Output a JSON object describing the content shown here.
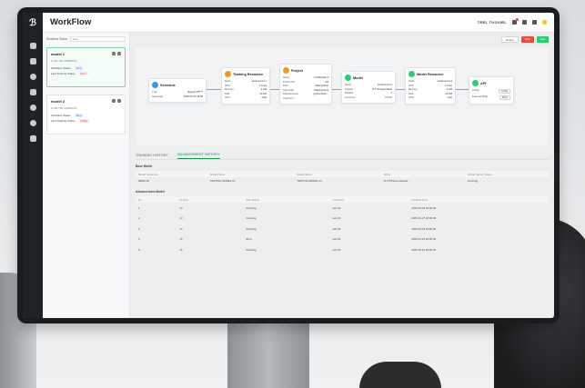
{
  "app": {
    "title": "WorkFlow"
  },
  "topbar": {
    "user_name": "TEEL TUOVIEL"
  },
  "filter": {
    "label": "Workflow Status",
    "value": "Stop"
  },
  "models": [
    {
      "name": "model 1",
      "subtitle": "2 GB / 6E 4 RMEXI%",
      "status_label": "Workflow Status",
      "status_value": "Stop",
      "training_label": "Last Training Status",
      "training_value": "Error"
    },
    {
      "name": "model 2",
      "subtitle": "2 GB / 6E 4 RMEXI%",
      "status_label": "Workflow Status",
      "status_value": "Stop",
      "training_label": "Last Training Status",
      "training_value": "Finish"
    }
  ],
  "actions": {
    "delete": "Delete",
    "stop": "Stop",
    "edit": "Edit"
  },
  "nodes": {
    "schedule": {
      "title": "Schedule",
      "rows": [
        [
          "Type",
          "Repeat 0/5**?"
        ],
        [
          "Start Date",
          "2025-01-03 18:00"
        ]
      ]
    },
    "training": {
      "title": "Training Resource",
      "rows": [
        [
          "Node",
          "workerpoint-1"
        ],
        [
          "GPU",
          "2 Core"
        ],
        [
          "Memory",
          "4 GB"
        ],
        [
          "Disk",
          "20 GB"
        ],
        [
          "GPU",
          "GA0"
        ]
      ]
    },
    "project": {
      "title": "Project",
      "rows": [
        [
          "Name",
          "mnistEcode-3"
        ],
        [
          "Python Ver.",
          "3.8"
        ],
        [
          "Path",
          "/data/python"
        ],
        [
          "Date Path",
          "/data/python3"
        ],
        [
          "Requirements",
          "/python/test/..."
        ],
        [
          "Argument",
          ""
        ]
      ]
    },
    "model": {
      "title": "Model",
      "rows": [
        [
          "Name",
          "workerpoint-3"
        ],
        [
          "Creator",
          "R.1797/secondant"
        ],
        [
          "Replica",
          "1"
        ],
        [
          "Comment",
          "CCCC"
        ]
      ]
    },
    "model_resource": {
      "title": "Model Resource",
      "rows": [
        [
          "Node",
          "workerpoint-4"
        ],
        [
          "GPU",
          "2 Core"
        ],
        [
          "Memory",
          "4 GB"
        ],
        [
          "Disk",
          "20 GB"
        ],
        [
          "GPU",
          "GA0"
        ]
      ]
    },
    "api": {
      "title": "API",
      "rows": [
        [
          "Config",
          "Config"
        ],
        [
          "Example Body",
          "Body"
        ]
      ]
    }
  },
  "tabs": {
    "training": "TRAINING HISTORY",
    "advancement": "ADVANCEMENT HISTORY"
  },
  "base_model": {
    "title": "Base Model",
    "headers": [
      "Model Sequence",
      "Model Name",
      "Model Name",
      "Writer",
      "Model Server Status"
    ],
    "rows": [
      [
        "SERV-48",
        "TESTING MODEL 01",
        "TESTING MODEL 01",
        "R.1797/secondarinel",
        "Running"
      ]
    ]
  },
  "advancement_model": {
    "title": "Advancement Model",
    "headers": [
      "No",
      "Version",
      "Run Status",
      "Comment",
      "Updated Time"
    ],
    "rows": [
      [
        "1",
        "v3",
        "Running",
        "test 01",
        "2025-01-03 18:00:00"
      ],
      [
        "2",
        "v3",
        "Running",
        "test 02",
        "2025-01-27 18:00:00"
      ],
      [
        "3",
        "v4",
        "Running",
        "test 03",
        "2025-01-19 18:00:00"
      ],
      [
        "4",
        "v6",
        "Error",
        "test 04",
        "2025-01-15 18:00:00"
      ],
      [
        "5",
        "v6",
        "Running",
        "test 05",
        "2025-02-10 18:00:00"
      ]
    ]
  }
}
